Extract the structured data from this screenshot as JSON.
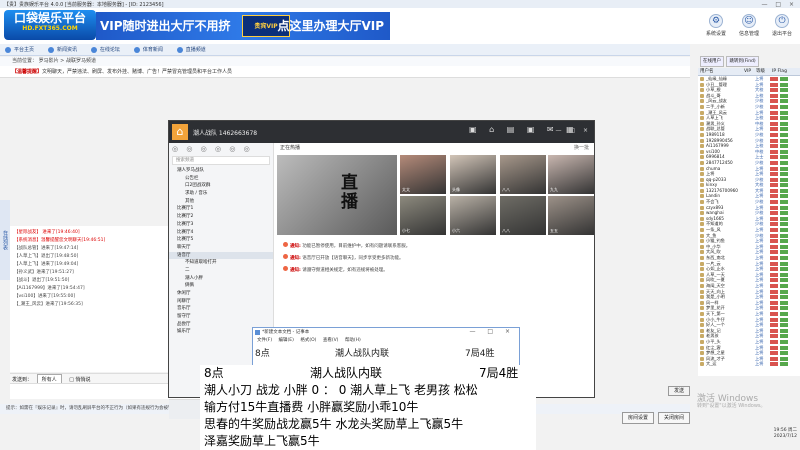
{
  "window": {
    "title": "【贵】贵族娱乐平台 4.0.0 [当前服务器：本地服务器]  -  [ID: 2123456]",
    "controls": "— □ ×"
  },
  "banner": {
    "logo_text": "口袋娱乐平台",
    "logo_sub": "HD.FXT365.COM",
    "ad_left": "VIP随时进出大厅不用挤",
    "ad_mid": "贵宾VIP",
    "ad_right": "点这里办理大厅VIP",
    "buttons": [
      {
        "label": "系统设置",
        "icon": "gear-icon",
        "glyph": "⚙"
      },
      {
        "label": "信息管理",
        "icon": "user-icon",
        "glyph": "☺"
      },
      {
        "label": "退出平台",
        "icon": "exit-icon",
        "glyph": "⏻"
      }
    ]
  },
  "nav": {
    "items": [
      "平台主页",
      "新闻资讯",
      "在线论坛",
      "体育新闻",
      "直播频道"
    ]
  },
  "address": {
    "text": "当前位置：  罗马影片  >  战联罗马频道"
  },
  "notice": {
    "label": "【温馨提醒】",
    "text": "文明聊天，严禁违法、刷屏、发布外挂、赌博、广告！严禁冒充管理员和平台工作人员"
  },
  "left_rail": {
    "label": "在线列表"
  },
  "chat_log": [
    {
      "text": "【星际战友】 进来了[19:46:40]",
      "red": false
    },
    {
      "text": "【系统消息】温馨提醒您文明聊天[19:46:51]",
      "red": true
    },
    {
      "text": "【战队总管】进来了[19:47:14]",
      "red": false
    },
    {
      "text": "【人草上飞】退出了[19:48:50]",
      "red": false
    },
    {
      "text": "【人草上飞】进来了[19:49:04]",
      "red": false
    },
    {
      "text": "【孙义武】进来了[19:51:27]",
      "red": false
    },
    {
      "text": "【战斗】退出了[19:51:50]",
      "red": false
    },
    {
      "text": "【Ai1167999】进来了[19:54:47]",
      "red": false
    },
    {
      "text": "【vsi100】进来了[19:55:00]",
      "red": false
    },
    {
      "text": "【_潮王_风云】进来了[19:56:35]",
      "red": false
    }
  ],
  "text_settings": {
    "label": "发送到：",
    "selected": "所有人",
    "opt": "□ 悄悄说"
  },
  "send_button": "发送",
  "tip_bar": {
    "text": "提示：如需在『娱乐记录』时，请勿乱刷屏平台的不正行为（如果有违规行为会被管理员踢出）"
  },
  "bottom_buttons": [
    "房间设置",
    "关闭房间"
  ],
  "watermark": {
    "line1": "激活 Windows",
    "line2": "转到\"设置\"以激活 Windows。"
  },
  "clock": {
    "time": "19:56 周二",
    "date": "2023/7/12"
  },
  "right_panel": {
    "tabs": [
      "在线用户",
      "跳转到(Find)"
    ],
    "headers": [
      "用户名",
      "VIP",
      "等级",
      "IP Flag"
    ],
    "users": [
      {
        "name": "_仙缘_仙缘",
        "rank": "上将"
      },
      {
        "name": "小丑__管理",
        "rank": "上将"
      },
      {
        "name": "小草_根",
        "rank": "大校"
      },
      {
        "name": "战斗_哥",
        "rank": "上校"
      },
      {
        "name": "_风云_战友",
        "rank": "少校"
      },
      {
        "name": "二手_小新",
        "rank": "少校"
      },
      {
        "name": "_潮王_风云",
        "rank": "上将"
      },
      {
        "name": "人草上飞",
        "rank": "上校"
      },
      {
        "name": "潮男_孙义",
        "rank": "中校"
      },
      {
        "name": "战联_总管",
        "rank": "上将"
      },
      {
        "name": "1989118",
        "rank": "少校"
      },
      {
        "name": "1928990456",
        "rank": "少校"
      },
      {
        "name": "Ai1167999",
        "rank": "上校"
      },
      {
        "name": "vsi100",
        "rank": "中校"
      },
      {
        "name": "6996814",
        "rank": "上士"
      },
      {
        "name": "2847712450",
        "rank": "少校"
      },
      {
        "name": "chuma",
        "rank": "上将"
      },
      {
        "name": "上将",
        "rank": "上将"
      },
      {
        "name": "qq-p2033",
        "rank": "少校"
      },
      {
        "name": "kinxy",
        "rank": "大校"
      },
      {
        "name": "132176700960",
        "rank": "大将"
      },
      {
        "name": "Landin",
        "rank": "上将"
      },
      {
        "name": "不会飞",
        "rank": "少校"
      },
      {
        "name": "czyx893",
        "rank": "上将"
      },
      {
        "name": "wanghai",
        "rank": "少校"
      },
      {
        "name": "sdy1665",
        "rank": "上将"
      },
      {
        "name": "不知道的",
        "rank": "少校"
      },
      {
        "name": "一条_风",
        "rank": "上将"
      },
      {
        "name": "大_鱼",
        "rank": "少校"
      },
      {
        "name": "小猫_钓鱼",
        "rank": "上将"
      },
      {
        "name": "中_小华",
        "rank": "上将"
      },
      {
        "name": "大风_吹",
        "rank": "上将"
      },
      {
        "name": "东西_南北",
        "rank": "上将"
      },
      {
        "name": "一片_云",
        "rank": "上将"
      },
      {
        "name": "心如_止水",
        "rank": "上将"
      },
      {
        "name": "人草_一天",
        "rank": "上将"
      },
      {
        "name": "风吹_一夏",
        "rank": "上将"
      },
      {
        "name": "海阔_天空",
        "rank": "上将"
      },
      {
        "name": "天天_向上",
        "rank": "上将"
      },
      {
        "name": "我是_小明",
        "rank": "上将"
      },
      {
        "name": "风一样",
        "rank": "上将"
      },
      {
        "name": "梦里_花开",
        "rank": "上将"
      },
      {
        "name": "天下_第一",
        "rank": "上将"
      },
      {
        "name": "小小_牛仔",
        "rank": "上将"
      },
      {
        "name": "好人_一个",
        "rank": "上将"
      },
      {
        "name": "老友_记",
        "rank": "上将"
      },
      {
        "name": "老男孩",
        "rank": "上将"
      },
      {
        "name": "小平_头",
        "rank": "上将"
      },
      {
        "name": "红尘_客",
        "rank": "上将"
      },
      {
        "name": "梦想_之星",
        "rank": "上将"
      },
      {
        "name": "风流_才子",
        "rank": "上将"
      },
      {
        "name": "大_运",
        "rank": "上将"
      }
    ]
  },
  "qq": {
    "name": "潮人战队  1462663678",
    "icons": "▣ ⌂ ▤ ▣ ✉ ▦",
    "controls": "— □ ×",
    "side_tools": "◎ ◎ ◎ ◎ ◎ ◎",
    "search_placeholder": "搜索频道",
    "channels": [
      {
        "label": "潮人罗马战队",
        "sub": false,
        "sel": false
      },
      {
        "label": "公告栏",
        "sub": true,
        "sel": false
      },
      {
        "label": "口2团战双群",
        "sub": true,
        "sel": false
      },
      {
        "label": "求助 / 音乐",
        "sub": true,
        "sel": false
      },
      {
        "label": "其他",
        "sub": true,
        "sel": false
      },
      {
        "label": "比赛厅1",
        "sub": false,
        "sel": false
      },
      {
        "label": "比赛厅2",
        "sub": false,
        "sel": false
      },
      {
        "label": "比赛厅3",
        "sub": false,
        "sel": false
      },
      {
        "label": "比赛厅4",
        "sub": false,
        "sel": false
      },
      {
        "label": "比赛厅5",
        "sub": false,
        "sel": false
      },
      {
        "label": "聊天厅",
        "sub": false,
        "sel": false
      },
      {
        "label": "语音厅",
        "sub": false,
        "sel": true
      },
      {
        "label": "不知道取啥打开",
        "sub": true,
        "sel": false
      },
      {
        "label": "二",
        "sub": true,
        "sel": false
      },
      {
        "label": "潮人小胖",
        "sub": true,
        "sel": false
      },
      {
        "label": "俩俩",
        "sub": true,
        "sel": false
      },
      {
        "label": "休闲厅",
        "sub": false,
        "sel": false
      },
      {
        "label": "闲聊厅",
        "sub": false,
        "sel": false
      },
      {
        "label": "音乐厅",
        "sub": false,
        "sel": false
      },
      {
        "label": "留守厅",
        "sub": false,
        "sel": false
      },
      {
        "label": "品尝厅",
        "sub": false,
        "sel": false
      },
      {
        "label": "娱乐厅",
        "sub": false,
        "sel": false
      }
    ],
    "hot_label": "正在热播",
    "hot_more": "换一批",
    "big_text": "直播",
    "thumbs": [
      "太太",
      "头像",
      "八八",
      "九九",
      "小七",
      "小六",
      "八八",
      "五五"
    ],
    "messages": [
      {
        "bold": "通知:",
        "text": "功能已暂停使用，目前维护中，如有问题请联系客服。"
      },
      {
        "bold": "通知:",
        "text": "语音厅已开放【语音聊天】，同步享受更多新功能。"
      },
      {
        "bold": "通知:",
        "text": "请遵守频道相关规定，如有违规将被处理。"
      }
    ]
  },
  "notepad": {
    "title": "*新建文本文档 - 记事本",
    "controls": "— □ ×",
    "menu": [
      "文件(F)",
      "编辑(E)",
      "格式(O)",
      "查看(V)",
      "帮助(H)"
    ],
    "line1_a": "8点",
    "line1_b": "潮人战队内联",
    "line1_c": "7局4胜"
  },
  "overlay_text": {
    "line1_a": "8点",
    "line1_b": "潮人战队内联",
    "line1_c": "7局4胜",
    "line2": "潮人小刀 战龙 小胖  0  ：  0    潮人草上飞 老男孩 松松",
    "line3": "输方付15牛直播费    小胖赢奖励小乖10牛",
    "line4": "思春的牛奖励战龙赢5牛 水龙头奖励草上飞赢5牛",
    "line5": "泽嘉奖励草上飞赢5牛"
  }
}
